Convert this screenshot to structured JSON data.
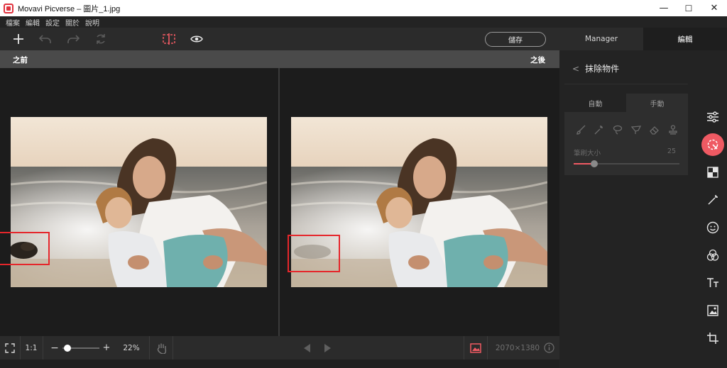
{
  "window": {
    "title": "Movavi Picverse – 圖片_1.jpg",
    "minimize": "—",
    "maximize": "☐",
    "close": "✕"
  },
  "menu": [
    "檔案",
    "編輯",
    "設定",
    "關於",
    "說明"
  ],
  "toolbar": {
    "save_label": "儲存"
  },
  "top_tabs": [
    {
      "label": "Manager"
    },
    {
      "label": "編輯"
    }
  ],
  "compare": {
    "before_label": "之前",
    "after_label": "之後"
  },
  "bottom": {
    "fit_label": "1:1",
    "zoom_minus": "−",
    "zoom_plus": "+",
    "zoom_value": "22%",
    "dimensions": "2070×1380",
    "zoom_level": 0.22
  },
  "panel": {
    "back_label": "<",
    "title": "抹除物件",
    "tabs": [
      {
        "label": "自動"
      },
      {
        "label": "手動"
      }
    ],
    "brush_label": "筆刷大小",
    "brush_value": "25"
  },
  "colors": {
    "accent": "#ef5a63",
    "bg": "#1c1c1c",
    "panel": "#232323"
  },
  "sidebar_icons": [
    "adjust-icon",
    "erase-object-icon",
    "background-icon",
    "magic-wand-icon",
    "face-retouch-icon",
    "filters-icon",
    "text-icon",
    "image-icon",
    "crop-icon"
  ]
}
